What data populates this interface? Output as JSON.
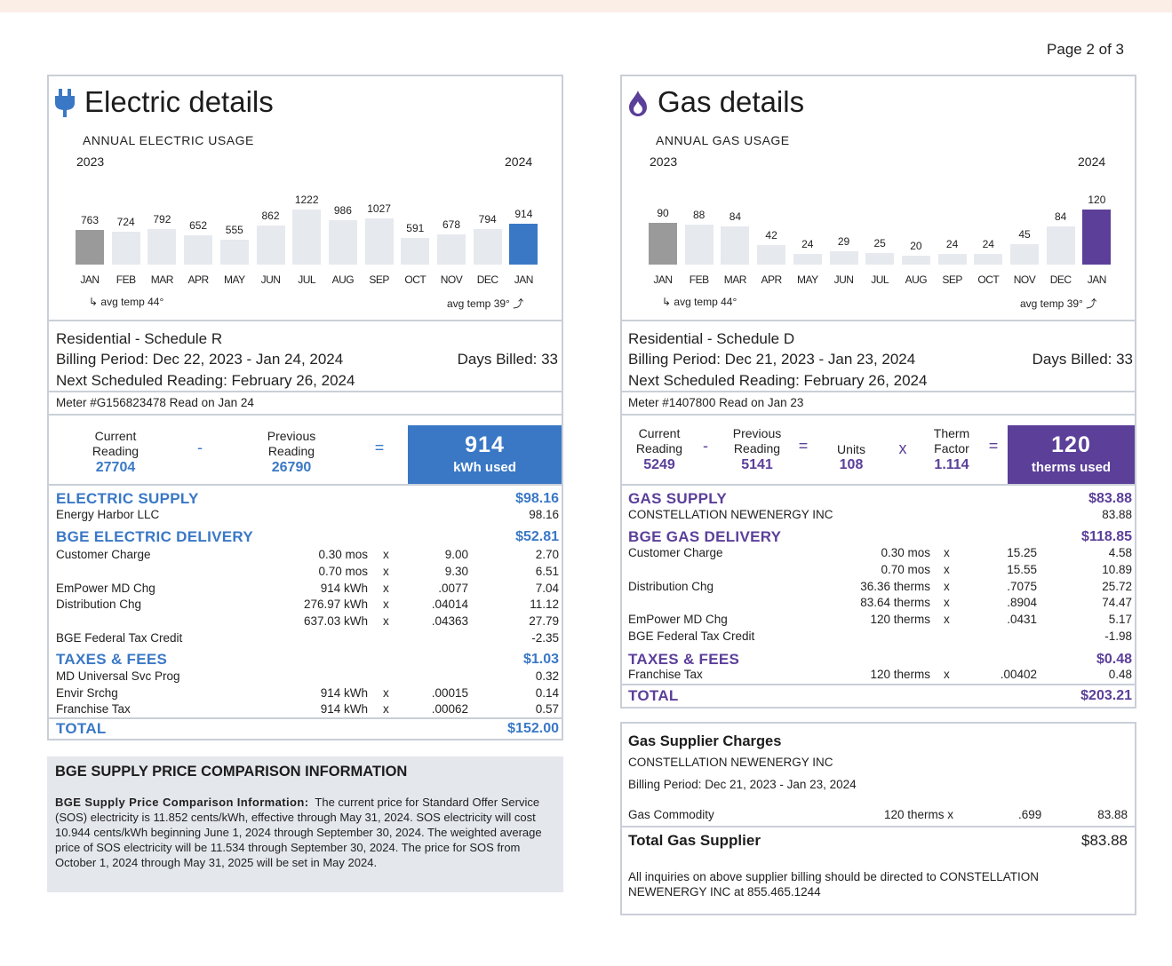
{
  "page_number": "Page 2 of 3",
  "colors": {
    "electric_accent": "#3a78c6",
    "gas_accent": "#5b3f99",
    "last_year_bar": "#9a9a9a",
    "bar": "#e6e9ee",
    "panel_border": "#c9cfd8"
  },
  "electric": {
    "icon": "plug-icon",
    "title": "Electric details",
    "annual_label": "ANNUAL ELECTRIC USAGE",
    "year_start": "2023",
    "year_end": "2024",
    "avg_temp_start": "avg temp 44°",
    "avg_temp_end": "avg temp 39°",
    "chart_data": {
      "type": "bar",
      "categories": [
        "JAN",
        "FEB",
        "MAR",
        "APR",
        "MAY",
        "JUN",
        "JUL",
        "AUG",
        "SEP",
        "OCT",
        "NOV",
        "DEC",
        "JAN"
      ],
      "values": [
        763,
        724,
        792,
        652,
        555,
        862,
        1222,
        986,
        1027,
        591,
        678,
        794,
        914
      ],
      "title": "ANNUAL ELECTRIC USAGE"
    },
    "schedule": "Residential - Schedule R",
    "billing_period": "Billing Period: Dec 22, 2023 - Jan 24, 2024",
    "days_billed": "Days Billed: 33",
    "next_reading": "Next Scheduled Reading: February 26, 2024",
    "meter": "Meter #G156823478  Read on Jan 24",
    "current_label_1": "Current",
    "current_label_2": "Reading",
    "current_value": "27704",
    "minus": "-",
    "previous_label_1": "Previous",
    "previous_label_2": "Reading",
    "previous_value": "26790",
    "equals": "=",
    "used_value": "914",
    "used_unit": "kWh used",
    "supply": {
      "heading": "ELECTRIC SUPPLY",
      "amount": "$98.16",
      "supplier": "Energy Harbor LLC",
      "supplier_amount": "98.16"
    },
    "delivery": {
      "heading": "BGE ELECTRIC DELIVERY",
      "amount": "$52.81",
      "rows": [
        {
          "label": "Customer Charge",
          "qty": "0.30 mos",
          "x": "x",
          "rate": "9.00",
          "amount": "2.70"
        },
        {
          "label": "",
          "qty": "0.70 mos",
          "x": "x",
          "rate": "9.30",
          "amount": "6.51"
        },
        {
          "label": "EmPower MD Chg",
          "qty": "914 kWh",
          "x": "x",
          "rate": ".0077",
          "amount": "7.04"
        },
        {
          "label": "Distribution Chg",
          "qty": "276.97 kWh",
          "x": "x",
          "rate": ".04014",
          "amount": "11.12"
        },
        {
          "label": "",
          "qty": "637.03 kWh",
          "x": "x",
          "rate": ".04363",
          "amount": "27.79"
        },
        {
          "label": "BGE Federal Tax Credit",
          "qty": "",
          "x": "",
          "rate": "",
          "amount": "-2.35"
        }
      ]
    },
    "taxes": {
      "heading": "TAXES & FEES",
      "amount": "$1.03",
      "rows": [
        {
          "label": "MD Universal Svc Prog",
          "qty": "",
          "x": "",
          "rate": "",
          "amount": "0.32"
        },
        {
          "label": "Envir Srchg",
          "qty": "914 kWh",
          "x": "x",
          "rate": ".00015",
          "amount": "0.14"
        },
        {
          "label": "Franchise Tax",
          "qty": "914 kWh",
          "x": "x",
          "rate": ".00062",
          "amount": "0.57"
        }
      ]
    },
    "total_label": "TOTAL",
    "total_amount": "$152.00"
  },
  "gas": {
    "icon": "flame-icon",
    "title": "Gas details",
    "annual_label": "ANNUAL GAS USAGE",
    "year_start": "2023",
    "year_end": "2024",
    "avg_temp_start": "avg temp 44°",
    "avg_temp_end": "avg temp 39°",
    "chart_data": {
      "type": "bar",
      "categories": [
        "JAN",
        "FEB",
        "MAR",
        "APR",
        "MAY",
        "JUN",
        "JUL",
        "AUG",
        "SEP",
        "OCT",
        "NOV",
        "DEC",
        "JAN"
      ],
      "values": [
        90,
        88,
        84,
        42,
        24,
        29,
        25,
        20,
        24,
        24,
        45,
        84,
        120
      ],
      "title": "ANNUAL GAS USAGE"
    },
    "schedule": "Residential - Schedule D",
    "billing_period": "Billing Period: Dec 21, 2023 - Jan 23, 2024",
    "days_billed": "Days Billed: 33",
    "next_reading": "Next Scheduled Reading: February 26, 2024",
    "meter": "Meter #1407800  Read on Jan 23",
    "current_label_1": "Current",
    "current_label_2": "Reading",
    "current_value": "5249",
    "minus": "-",
    "previous_label_1": "Previous",
    "previous_label_2": "Reading",
    "previous_value": "5141",
    "equals": "=",
    "units_label": "Units",
    "units_value": "108",
    "times": "x",
    "therm_label_1": "Therm",
    "therm_label_2": "Factor",
    "therm_value": "1.114",
    "equals2": "=",
    "used_value": "120",
    "used_unit": "therms used",
    "supply": {
      "heading": "GAS SUPPLY",
      "amount": "$83.88",
      "supplier": "CONSTELLATION NEWENERGY INC",
      "supplier_amount": "83.88"
    },
    "delivery": {
      "heading": "BGE GAS DELIVERY",
      "amount": "$118.85",
      "rows": [
        {
          "label": "Customer Charge",
          "qty": "0.30 mos",
          "x": "x",
          "rate": "15.25",
          "amount": "4.58"
        },
        {
          "label": "",
          "qty": "0.70 mos",
          "x": "x",
          "rate": "15.55",
          "amount": "10.89"
        },
        {
          "label": "Distribution Chg",
          "qty": "36.36 therms",
          "x": "x",
          "rate": ".7075",
          "amount": "25.72"
        },
        {
          "label": "",
          "qty": "83.64 therms",
          "x": "x",
          "rate": ".8904",
          "amount": "74.47"
        },
        {
          "label": "EmPower MD Chg",
          "qty": "120 therms",
          "x": "x",
          "rate": ".0431",
          "amount": "5.17"
        },
        {
          "label": "BGE Federal Tax Credit",
          "qty": "",
          "x": "",
          "rate": "",
          "amount": "-1.98"
        }
      ]
    },
    "taxes": {
      "heading": "TAXES & FEES",
      "amount": "$0.48",
      "rows": [
        {
          "label": "Franchise Tax",
          "qty": "120 therms",
          "x": "x",
          "rate": ".00402",
          "amount": "0.48"
        }
      ]
    },
    "total_label": "TOTAL",
    "total_amount": "$203.21"
  },
  "comparison": {
    "heading": "BGE SUPPLY PRICE COMPARISON INFORMATION",
    "lead": "BGE Supply Price Comparison Information:",
    "body": "The current price for Standard Offer Service (SOS) electricity is 11.852 cents/kWh, effective through May 31, 2024. SOS electricity will cost 10.944 cents/kWh beginning June 1, 2024 through September 30, 2024. The weighted average price of SOS electricity will be 11.534 through September 30, 2024. The price for SOS from October 1, 2024 through May 31, 2025 will be set in May 2024."
  },
  "supplier_charges": {
    "heading": "Gas Supplier Charges",
    "supplier": "CONSTELLATION NEWENERGY INC",
    "billing_period": "Billing Period: Dec 21, 2023 - Jan 23, 2024",
    "row_label": "Gas Commodity",
    "row_qty": "120 therms  x",
    "row_rate": ".699",
    "row_amount": "83.88",
    "total_label": "Total Gas Supplier",
    "total_amount": "$83.88",
    "note": "All inquiries on above supplier billing should be directed to CONSTELLATION NEWENERGY INC at 855.465.1244"
  }
}
